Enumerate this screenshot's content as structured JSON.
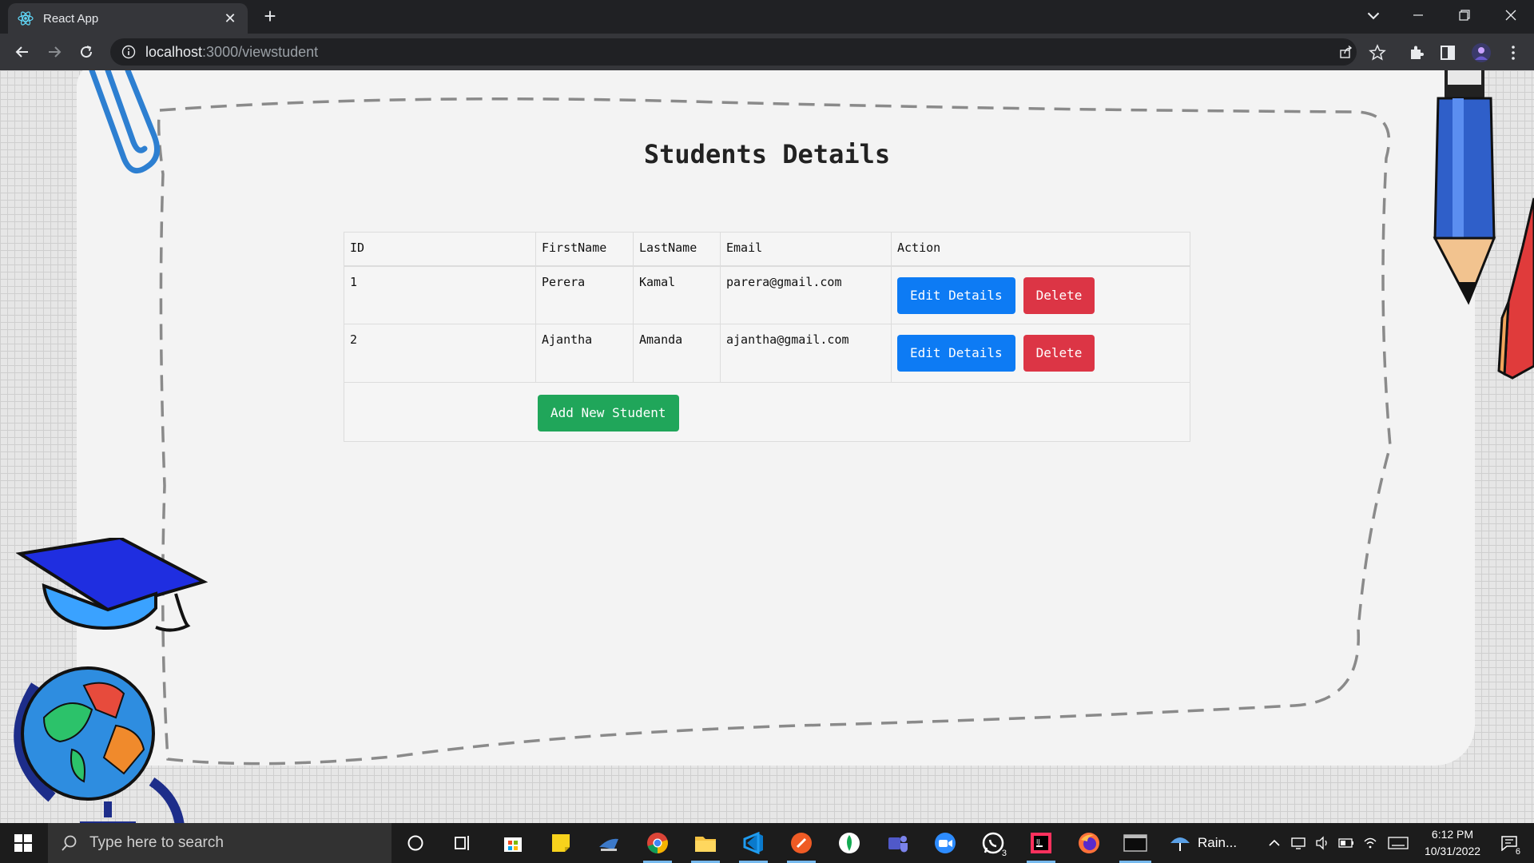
{
  "browser": {
    "tab_title": "React App",
    "url_host": "localhost",
    "url_path": ":3000/viewstudent"
  },
  "page": {
    "heading": "Students Details",
    "table": {
      "headers": [
        "ID",
        "FirstName",
        "LastName",
        "Email",
        "Action"
      ],
      "rows": [
        {
          "id": "1",
          "first_name": "Perera",
          "last_name": "Kamal",
          "email": "parera@gmail.com"
        },
        {
          "id": "2",
          "first_name": "Ajantha",
          "last_name": "Amanda",
          "email": "ajantha@gmail.com"
        }
      ],
      "edit_label": "Edit Details",
      "delete_label": "Delete",
      "add_label": "Add New Student"
    },
    "colors": {
      "edit": "#0d7bf4",
      "delete": "#dc3545",
      "add": "#20a65a"
    }
  },
  "taskbar": {
    "search_placeholder": "Type here to search",
    "weather": "Rain...",
    "time": "6:12 PM",
    "date": "10/31/2022",
    "whatsapp_badge": "3",
    "notification_count": "6"
  }
}
